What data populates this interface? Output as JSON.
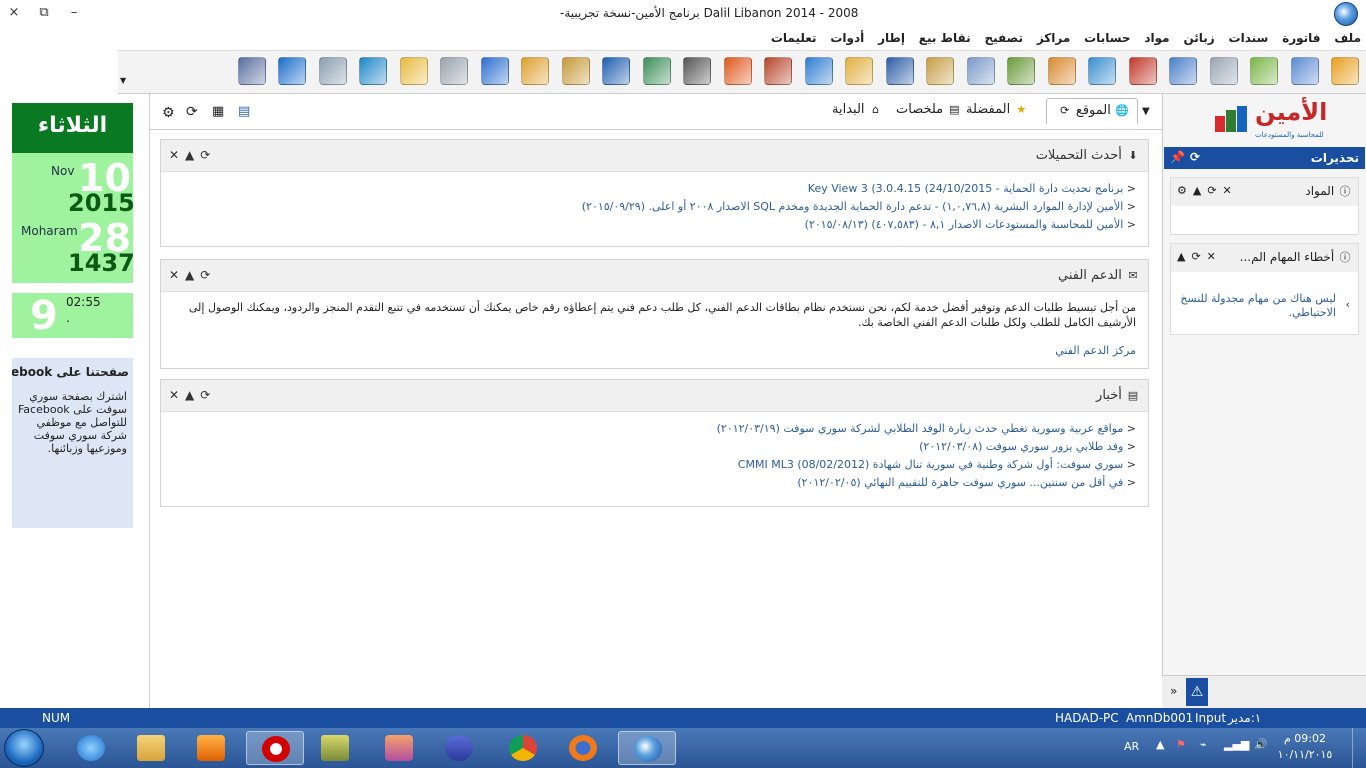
{
  "window": {
    "title": "-برنامج الأمين-نسخة تجريبية   Dalil Libanon 2014 - 2008",
    "controls": {
      "close": "×",
      "restore": "⧉",
      "minimize": "–"
    }
  },
  "menu": [
    "ملف",
    "فاتورة",
    "سندات",
    "زبائن",
    "مواد",
    "حسابات",
    "مراكز",
    "تصفيح",
    "نقاط بيع",
    "إطار",
    "أدوات",
    "تعليمات"
  ],
  "toolbar": {
    "colors": [
      "#e8a020",
      "#5b8ad4",
      "#7ab648",
      "#9aa6b4",
      "#4c80c8",
      "#c0392b",
      "#3a8fd0",
      "#d88a2e",
      "#6b9a3a",
      "#7a9ac8",
      "#c7a046",
      "#2e5fa8",
      "#e2b040",
      "#2e7fd1",
      "#b6472b",
      "#e05a20",
      "#555555",
      "#3d8f5a",
      "#1f5fb0",
      "#c69a3a",
      "#e0a030",
      "#2d6fd0",
      "#9aa2ad",
      "#e8bb40",
      "#1e88c8",
      "#8a9eb0",
      "#1b6fc9",
      "#5a6fa0"
    ]
  },
  "left_panel": {
    "day_name": "الثلاثاء",
    "gregorian": {
      "day": "10",
      "month": "Nov",
      "year": "2015"
    },
    "hijri": {
      "day": "28",
      "month": "Moharam",
      "year": "1437"
    },
    "clock": {
      "hour": "9",
      "time": "02:55",
      "sub": "."
    },
    "facebook": {
      "heading": "صفحتنا على facebook",
      "body": "اشترك بصفحة سوري سوفت على Facebook للتواصل مع موظفي شركة سوري سوفت وموزعيها وزبائنها."
    }
  },
  "tabs": [
    {
      "label": "الموقع",
      "icon": "globe-icon"
    },
    {
      "label": "المفضلة",
      "icon": "star-icon"
    },
    {
      "label": "ملخصات",
      "icon": "list-icon"
    },
    {
      "label": "البداية",
      "icon": "home-icon"
    }
  ],
  "portlets": {
    "downloads": {
      "title": "أحدث التحميلات",
      "items": [
        "برنامج تحديث دارة الحماية - Key View 3 (3.0.4.15 (24/10/2015",
        "الأمين لإدارة الموارد البشرية (١,٠,٧٦,٨) - تدعم دارة الحماية الجديدة ومخدم SQL الاصدار ٢٠٠٨ أو اعلى. (٢٠١٥/٠٩/٢٩)",
        "الأمين للمحاسبة والمستودعات الاصدار ٨,١ - (٤٠٧,٥٨٣) (٢٠١٥/٠٨/١٣)"
      ]
    },
    "support": {
      "title": "الدعم الفني",
      "body": "من أجل تبسيط طلبات الدعم وتوفير أفضل خدمة لكم، نحن نستخدم نظام بطاقات الدعم الفني، كل طلب دعم فني يتم إعطاؤه رقم خاص يمكنك أن تستخدمه في تتبع التقدم المنجز والردود، ويمكنك الوصول إلى الأرشيف الكامل للطلب ولكل طلبات الدعم الفني الخاصة بك.",
      "link": "مركز الدعم الفني"
    },
    "news": {
      "title": "أخبار",
      "items": [
        "مواقع عربية وسورية تغطي حدث زيارة الوفد الطلابي لشركة سوري سوفت (٢٠١٢/٠٣/١٩)",
        "وفد طلابي يزور سوري سوفت (٢٠١٢/٠٣/٠٨)",
        "سوري سوفت: أول شركة وطنية في سورية تنال شهادة CMMI ML3 (08/02/2012)",
        "في أقل من سنتين... سوري سوفت جاهزة للتقييم النهائي (٢٠١٢/٠٢/٠٥)"
      ]
    }
  },
  "right_panel": {
    "logo_text": "الأمين",
    "logo_sub": "للمحاسبة والمستودعات",
    "alerts_title": "تحذيرات",
    "materials_title": "المواد",
    "tasks_title": "أخطاء المهام الم...",
    "tasks_body": "ليس هناك من مهام مجدولة للنسخ الاحتياطي."
  },
  "status_bar": {
    "num": "NUM",
    "pc": "HADAD-PC",
    "db": "AmnDb001",
    "mode": "Input",
    "user": "١:مدير"
  },
  "tray": {
    "lang": "AR",
    "time": "09:02 م",
    "date": "١٠/١١/٢٠١٥"
  }
}
